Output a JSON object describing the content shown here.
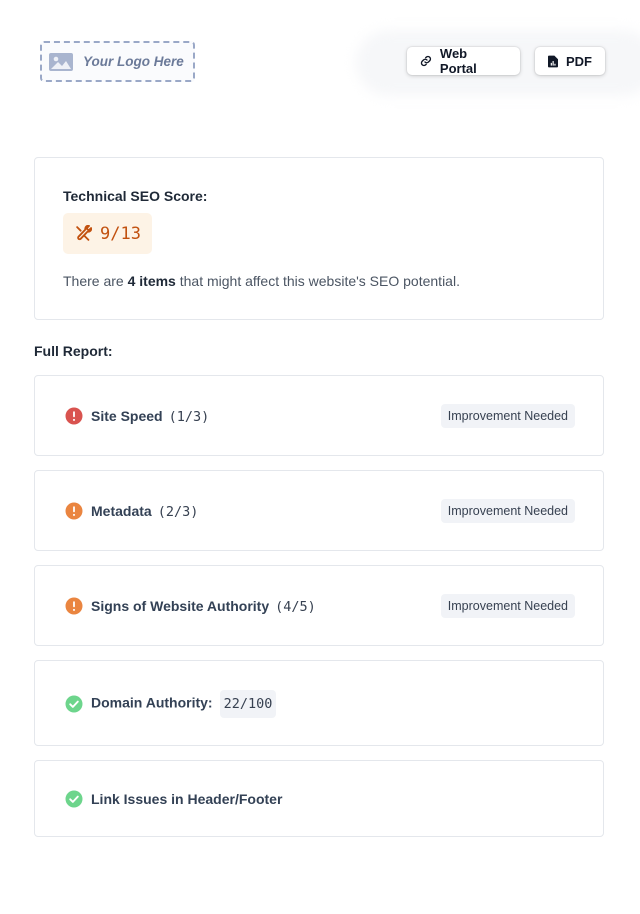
{
  "header": {
    "logo_text": "Your Logo Here",
    "logo_icon": "image-icon",
    "web_portal_label": "Web Portal",
    "web_portal_icon": "link-icon",
    "pdf_label": "PDF",
    "pdf_icon": "file-chart-icon"
  },
  "score": {
    "title": "Technical SEO Score:",
    "value": "9/13",
    "icon": "tools-icon",
    "desc_prefix": "There are ",
    "desc_count": "4 items",
    "desc_suffix": " that might affect this website's SEO potential."
  },
  "full_report_label": "Full Report:",
  "items": [
    {
      "label": "Site Speed",
      "score": "(1/3)",
      "status": "error",
      "tag": "Improvement Needed"
    },
    {
      "label": "Metadata",
      "score": "(2/3)",
      "status": "warning",
      "tag": "Improvement Needed"
    },
    {
      "label": "Signs of Website Authority",
      "score": "(4/5)",
      "status": "warning",
      "tag": "Improvement Needed"
    },
    {
      "label": "Domain Authority:",
      "value": "22/100",
      "status": "success"
    },
    {
      "label": "Link Issues in Header/Footer",
      "status": "success"
    }
  ],
  "colors": {
    "error": "#d9534f",
    "warning": "#ea8540",
    "success": "#6dd58c",
    "score_accent": "#c2510f"
  }
}
